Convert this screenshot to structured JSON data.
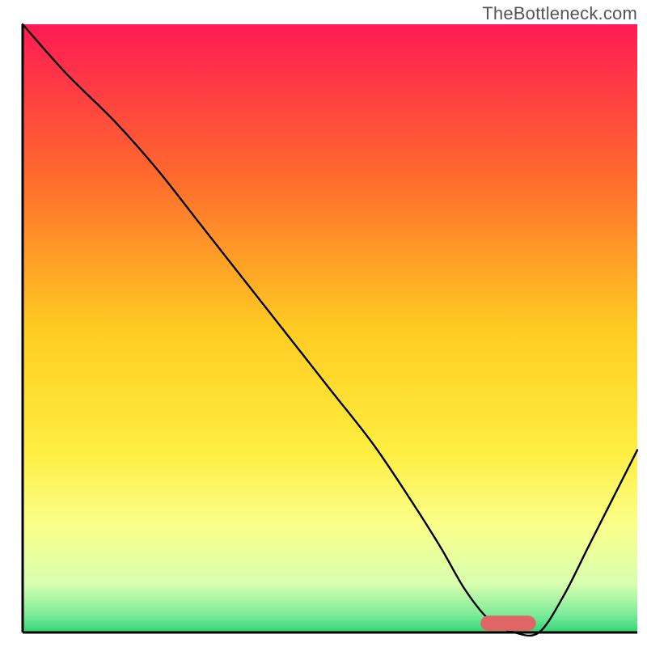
{
  "watermark": "TheBottleneck.com",
  "chart_data": {
    "type": "line",
    "title": "",
    "xlabel": "",
    "ylabel": "",
    "xlim": [
      0,
      100
    ],
    "ylim": [
      0,
      100
    ],
    "grid": false,
    "legend": false,
    "gradient_stops": [
      {
        "offset": 0.0,
        "color": "#ff1a55"
      },
      {
        "offset": 0.25,
        "color": "#ff6a2d"
      },
      {
        "offset": 0.5,
        "color": "#ffcb22"
      },
      {
        "offset": 0.7,
        "color": "#ffee40"
      },
      {
        "offset": 0.82,
        "color": "#fbff88"
      },
      {
        "offset": 0.92,
        "color": "#d8ffb0"
      },
      {
        "offset": 0.97,
        "color": "#7eec9a"
      },
      {
        "offset": 1.0,
        "color": "#2fd675"
      }
    ],
    "series": [
      {
        "name": "curve",
        "x": [
          0,
          7,
          15,
          22,
          29,
          36,
          43,
          50,
          57,
          63,
          68,
          72,
          76,
          80,
          84,
          88,
          92,
          96,
          100
        ],
        "y": [
          100,
          92,
          84,
          76,
          67,
          58,
          49,
          40,
          31,
          22,
          14,
          7,
          2,
          0,
          0,
          6,
          14,
          22,
          30
        ]
      }
    ],
    "marker": {
      "x": 79,
      "y": 0,
      "width": 9,
      "height": 2.5,
      "radius": 1.3,
      "color": "#e06666"
    },
    "axis_color": "#000000",
    "line_color": "#000000"
  }
}
